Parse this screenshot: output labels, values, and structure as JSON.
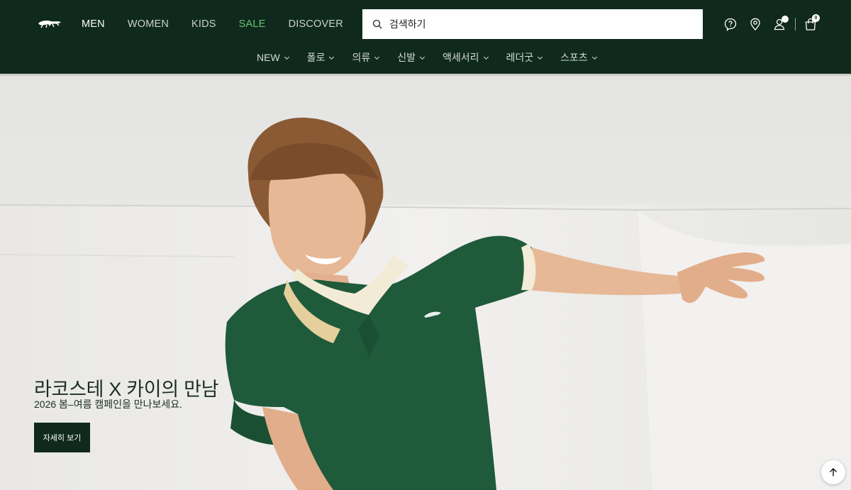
{
  "brand": {
    "logo_icon": "crocodile-logo-icon"
  },
  "nav": {
    "main": [
      {
        "label": "MEN"
      },
      {
        "label": "WOMEN"
      },
      {
        "label": "KIDS"
      },
      {
        "label": "SALE"
      },
      {
        "label": "DISCOVER"
      }
    ],
    "sub": [
      {
        "label": "NEW"
      },
      {
        "label": "폴로"
      },
      {
        "label": "의류"
      },
      {
        "label": "신발"
      },
      {
        "label": "액세서리"
      },
      {
        "label": "레더굿"
      },
      {
        "label": "스포츠"
      }
    ]
  },
  "search": {
    "placeholder": "검색하기",
    "icon": "search-icon"
  },
  "utilities": {
    "help_icon": "help-icon",
    "store_icon": "store-locator-icon",
    "account_icon": "account-icon",
    "bag_icon": "shopping-bag-icon",
    "bag_count": "0"
  },
  "hero": {
    "title": "라코스테 X 카이의 만남",
    "subtitle": "2026 봄–여름 캠페인을 만나보세요.",
    "cta_label": "자세히 보기"
  },
  "colors": {
    "header_bg": "#0f2a1c",
    "sale": "#6abf75",
    "cta_bg": "#0f2a1c"
  },
  "scroll_top_icon": "arrow-up-icon"
}
